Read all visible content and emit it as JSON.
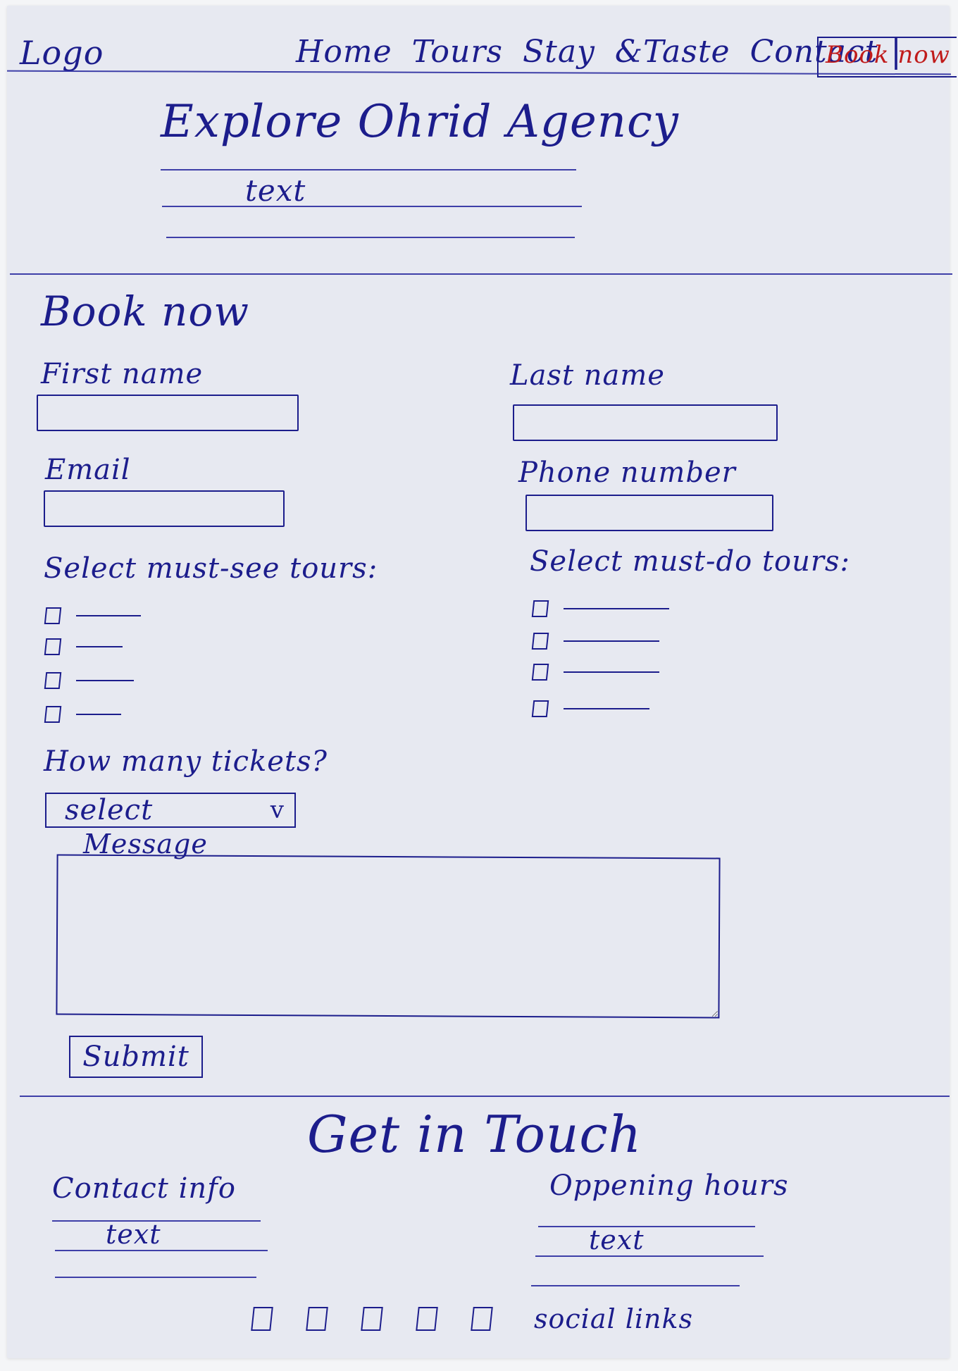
{
  "nav": {
    "logo": "Logo",
    "items": [
      "Home",
      "Tours",
      "Stay",
      "&Taste",
      "Contact"
    ],
    "separator": "|",
    "book_now": "Book now"
  },
  "hero": {
    "title": "Explore Ohrid Agency",
    "text": "text"
  },
  "booking": {
    "heading": "Book now",
    "first_name_label": "First name",
    "last_name_label": "Last name",
    "email_label": "Email",
    "phone_label": "Phone number",
    "must_see_label": "Select must-see tours:",
    "must_do_label": "Select must-do tours:",
    "tickets_label": "How many tickets?",
    "tickets_select": "select",
    "tickets_chevron": "v",
    "message_label": "Message",
    "submit": "Submit"
  },
  "contact": {
    "heading": "Get in Touch",
    "info_label": "Contact info",
    "info_text": "text",
    "hours_label": "Oppening hours",
    "hours_text": "text",
    "social_label": "social links"
  },
  "colors": {
    "ink": "#1c1d8c",
    "accent": "#c01b1b",
    "paper": "#e7e9f1"
  }
}
